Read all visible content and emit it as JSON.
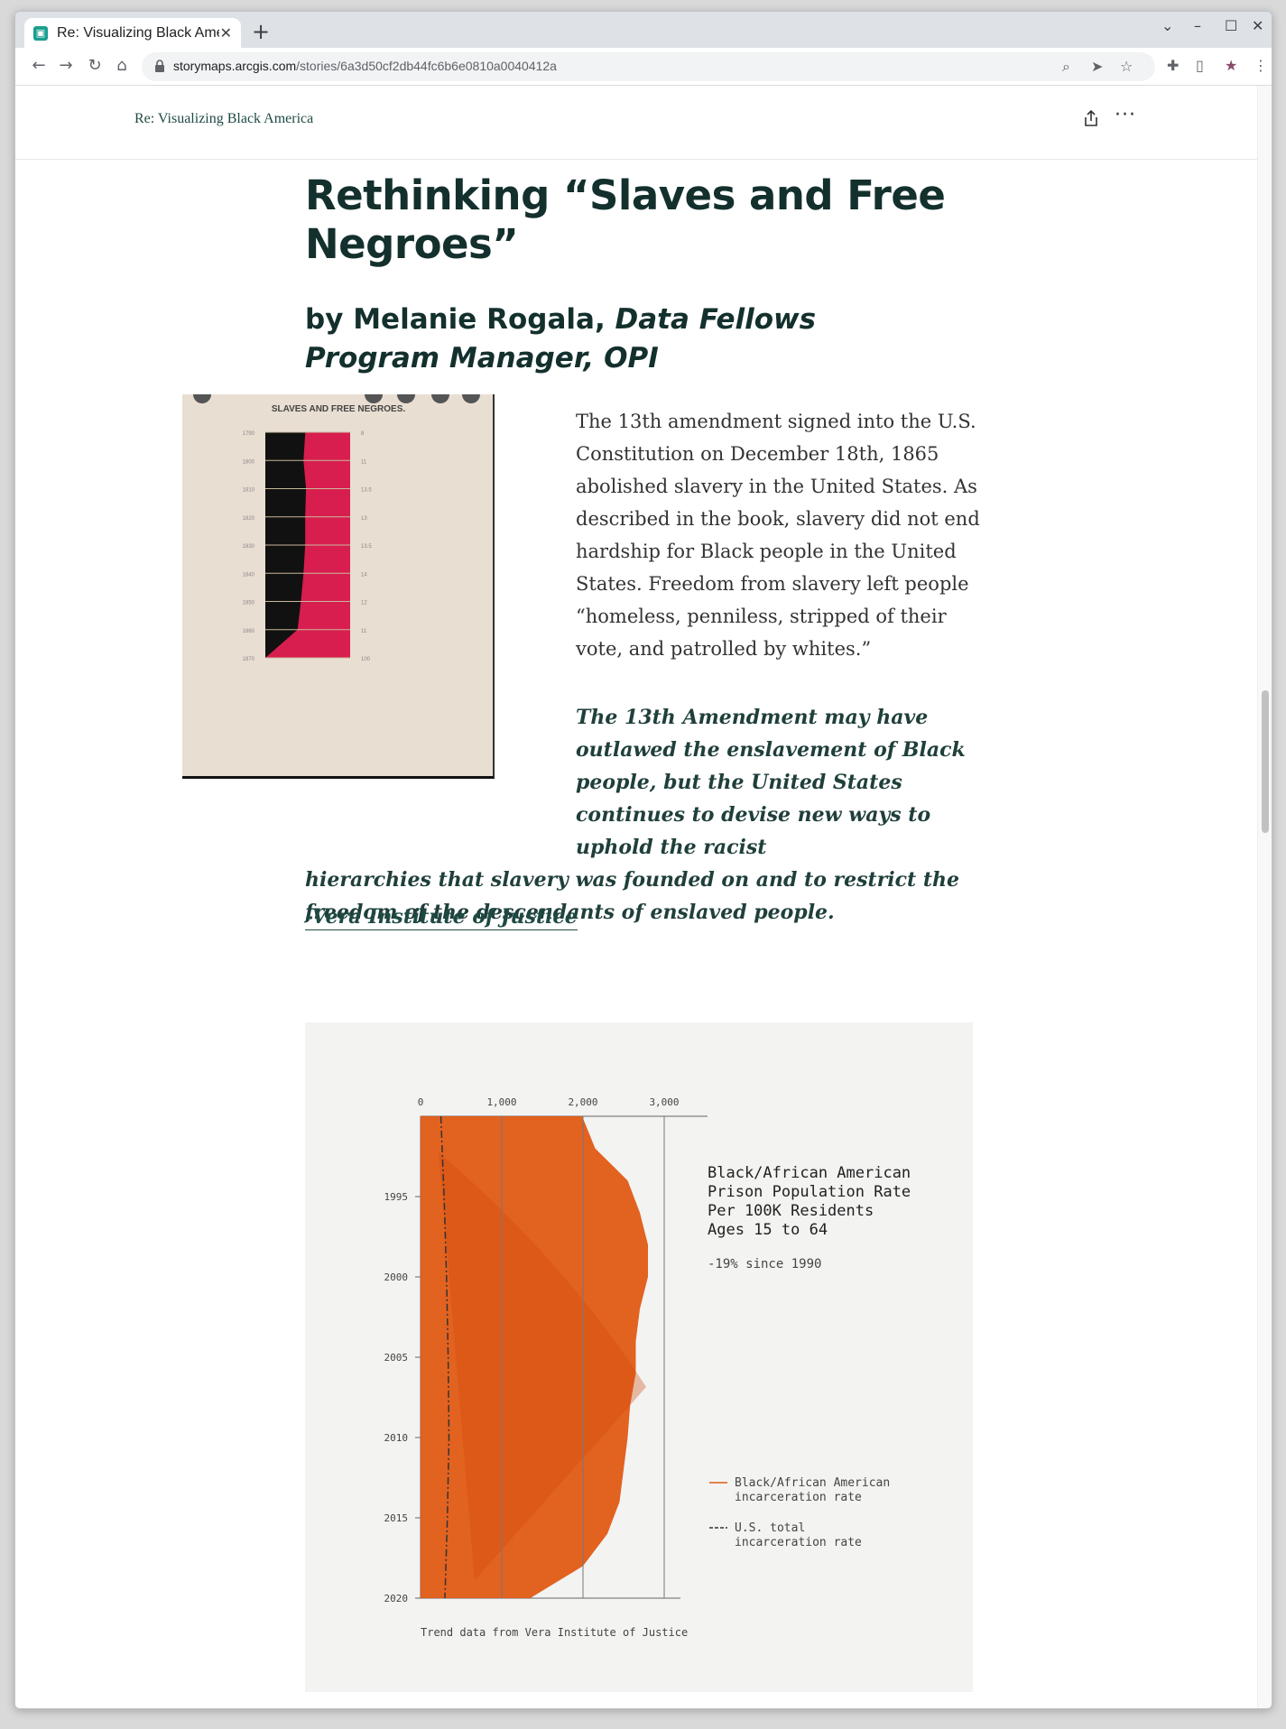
{
  "browser": {
    "tab_title": "Re: Visualizing Black Ame",
    "tab_close": "✕",
    "new_tab": "+",
    "url_host": "storymaps.arcgis.com",
    "url_path": "/stories/6a3d50cf2db44fc6b6e0810a0040412a",
    "window_controls": [
      "⌄",
      "–",
      "☐",
      "✕"
    ]
  },
  "site": {
    "name": "Re: Visualizing Black America",
    "share_icon": "share-icon",
    "more_icon": "more-icon"
  },
  "article": {
    "title": "Rethinking “Slaves and Free Negroes”",
    "byline_author": "by Melanie Rogala, ",
    "byline_role": "Data Fellows Program Manager, OPI",
    "paragraph": "The 13th amendment signed into the U.S. Constitution on December 18th, 1865 abolished slavery in the United States. As described in the book, slavery did not end hardship for Black people in the United States. Freedom from slavery left people “homeless, penniless, stripped of their vote, and patrolled by whites.”",
    "quote_line1": "The 13th Amendment may have outlawed the enslavement of Black people, but the United States continues to devise new ways to uphold the racist",
    "quote_line2": "hierarchies that slavery was founded on and to restrict the freedom of the descendants of enslaved people.",
    "attribution": " -Vera Institute of Justice"
  },
  "plate": {
    "title": "SLAVES AND FREE NEGROES.",
    "years": [
      "1790",
      "1800",
      "1810",
      "1820",
      "1830",
      "1840",
      "1850",
      "1860",
      "1870"
    ],
    "percents": [
      "8",
      "11",
      "13.5",
      "13",
      "13.5",
      "14",
      "12",
      "11",
      "100"
    ],
    "colors": {
      "slave": "#111111",
      "free": "#d81e4f",
      "paper": "#e8ddd0"
    }
  },
  "chart_data": {
    "type": "area",
    "title": "Black/African American Prison Population Rate Per 100K Residents Ages 15 to 64",
    "title_lines": [
      "Black/African American",
      "Prison Population Rate",
      "Per 100K Residents",
      "Ages 15 to 64"
    ],
    "subtitle": "-19% since 1990",
    "x_ticks": [
      "0",
      "1,000",
      "2,000",
      "3,000"
    ],
    "y_ticks": [
      "1995",
      "2000",
      "2005",
      "2010",
      "2015",
      "2020"
    ],
    "xlim": [
      0,
      3000
    ],
    "ylim": [
      1990,
      2020
    ],
    "orientation": "vertical-time",
    "series": [
      {
        "name": "Black/African American incarceration rate",
        "color": "#e05a14",
        "points": [
          [
            1990,
            1990
          ],
          [
            1992,
            2150
          ],
          [
            1994,
            2550
          ],
          [
            1996,
            2700
          ],
          [
            1998,
            2800
          ],
          [
            2000,
            2800
          ],
          [
            2002,
            2700
          ],
          [
            2004,
            2650
          ],
          [
            2006,
            2650
          ],
          [
            2008,
            2580
          ],
          [
            2010,
            2550
          ],
          [
            2012,
            2500
          ],
          [
            2014,
            2450
          ],
          [
            2016,
            2300
          ],
          [
            2018,
            2000
          ],
          [
            2020,
            1350
          ]
        ]
      },
      {
        "name": "U.S. total incarceration rate",
        "color": "#333333",
        "points": [
          [
            1990,
            250
          ],
          [
            1995,
            290
          ],
          [
            2000,
            320
          ],
          [
            2005,
            340
          ],
          [
            2010,
            350
          ],
          [
            2015,
            330
          ],
          [
            2020,
            300
          ]
        ]
      }
    ],
    "legend": [
      {
        "line1": "Black/African American",
        "line2": "incarceration rate"
      },
      {
        "line1": "U.S. total",
        "line2": "incarceration rate"
      }
    ],
    "legend_position": "right",
    "source": "Trend data from Vera Institute of Justice"
  }
}
